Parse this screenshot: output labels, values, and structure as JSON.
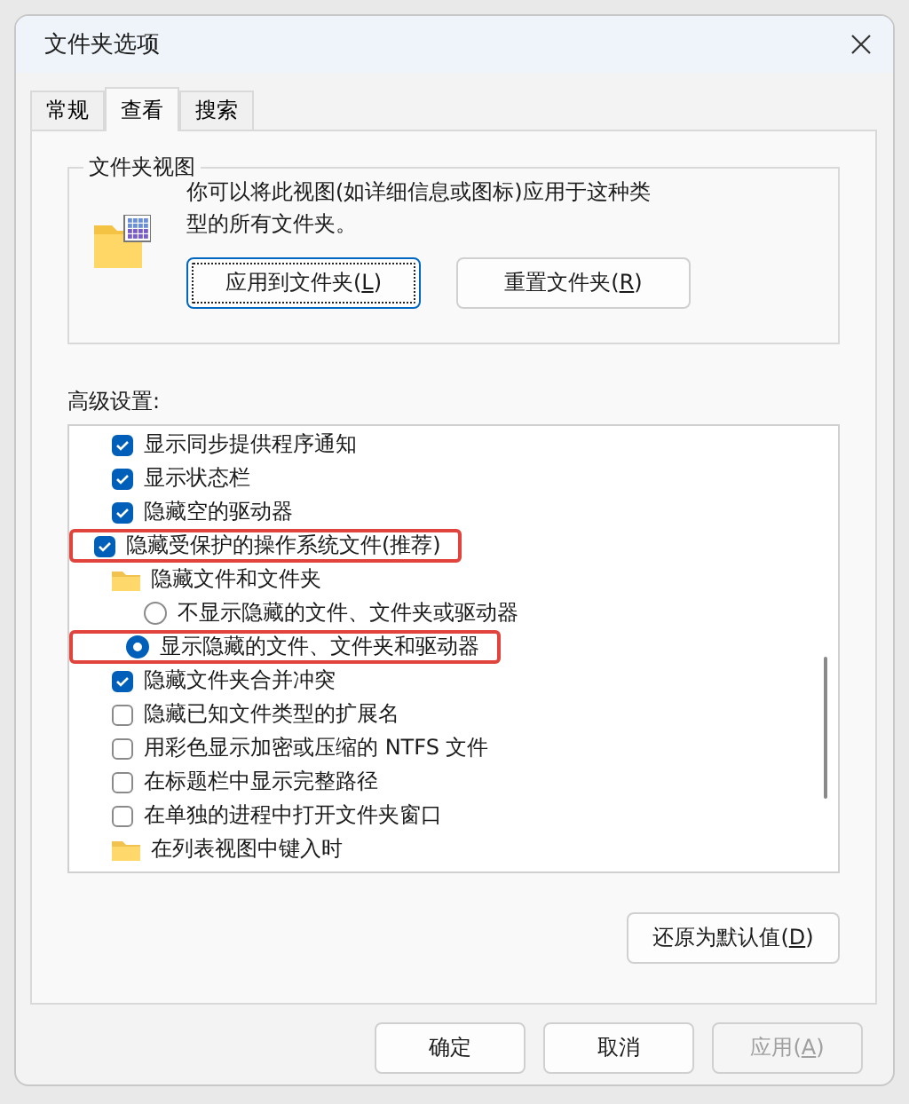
{
  "window": {
    "title": "文件夹选项"
  },
  "tabs": [
    {
      "label": "常规",
      "selected": false
    },
    {
      "label": "查看",
      "selected": true
    },
    {
      "label": "搜索",
      "selected": false
    }
  ],
  "folder_views": {
    "title": "文件夹视图",
    "description": "你可以将此视图(如详细信息或图标)应用于这种类型的所有文件夹。",
    "buttons": [
      {
        "text": "应用到文件夹(",
        "access_key": "L",
        "text_after": ")",
        "focused": true
      },
      {
        "text": "重置文件夹(",
        "access_key": "R",
        "text_after": ")",
        "focused": false
      }
    ]
  },
  "advanced": {
    "label": "高级设置:",
    "items": [
      {
        "kind": "checkbox",
        "label": "显示同步提供程序通知",
        "checked": true,
        "highlighted": false
      },
      {
        "kind": "checkbox",
        "label": "显示状态栏",
        "checked": true,
        "highlighted": false
      },
      {
        "kind": "checkbox",
        "label": "隐藏空的驱动器",
        "checked": true,
        "highlighted": false
      },
      {
        "kind": "checkbox",
        "label": "隐藏受保护的操作系统文件(推荐)",
        "checked": true,
        "highlighted": true
      },
      {
        "kind": "folder",
        "label": "隐藏文件和文件夹",
        "highlighted": false,
        "children": [
          {
            "kind": "radio",
            "label": "不显示隐藏的文件、文件夹或驱动器",
            "selected": false,
            "highlighted": false
          },
          {
            "kind": "radio",
            "label": "显示隐藏的文件、文件夹和驱动器",
            "selected": true,
            "highlighted": true
          }
        ]
      },
      {
        "kind": "checkbox",
        "label": "隐藏文件夹合并冲突",
        "checked": true,
        "highlighted": false
      },
      {
        "kind": "checkbox",
        "label": "隐藏已知文件类型的扩展名",
        "checked": false,
        "highlighted": false
      },
      {
        "kind": "checkbox",
        "label": "用彩色显示加密或压缩的 NTFS 文件",
        "checked": false,
        "highlighted": false
      },
      {
        "kind": "checkbox",
        "label": "在标题栏中显示完整路径",
        "checked": false,
        "highlighted": false
      },
      {
        "kind": "checkbox",
        "label": "在单独的进程中打开文件夹窗口",
        "checked": false,
        "highlighted": false
      },
      {
        "kind": "folder",
        "label": "在列表视图中键入时",
        "highlighted": false
      }
    ]
  },
  "restore_button": {
    "text": "还原为默认值(",
    "access_key": "D",
    "text_after": ")"
  },
  "footer_buttons": [
    {
      "text": "确定",
      "disabled": false
    },
    {
      "text": "取消",
      "disabled": false
    },
    {
      "text": "应用(",
      "access_key": "A",
      "text_after": ")",
      "disabled": true
    }
  ]
}
